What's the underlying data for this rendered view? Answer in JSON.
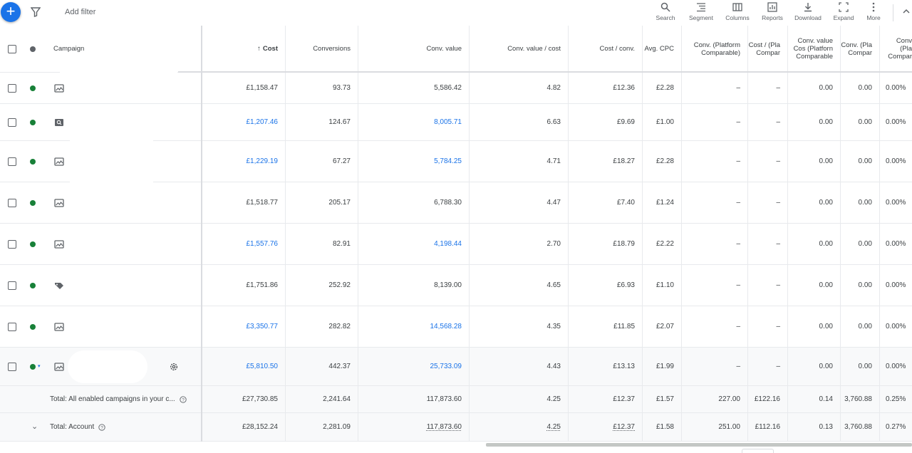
{
  "toolbar": {
    "add_filter": "Add filter",
    "tools": [
      {
        "label": "Search",
        "icon": "search-icon"
      },
      {
        "label": "Segment",
        "icon": "segment-icon"
      },
      {
        "label": "Columns",
        "icon": "columns-icon"
      },
      {
        "label": "Reports",
        "icon": "reports-icon"
      },
      {
        "label": "Download",
        "icon": "download-icon"
      },
      {
        "label": "Expand",
        "icon": "expand-icon"
      },
      {
        "label": "More",
        "icon": "more-icon"
      }
    ]
  },
  "columns": {
    "campaign": "Campaign",
    "cost": "Cost",
    "conversions": "Conversions",
    "conv_value": "Conv. value",
    "conv_value_cost": "Conv. value / cost",
    "cost_conv": "Cost / conv.",
    "avg_cpc": "Avg. CPC",
    "conv_platform": "Conv. (Platform Comparable)",
    "cost_per_platform": "Cost / (Pla Compar",
    "conv_value_cost_platform": "Conv. value Cos (Platforn Comparable",
    "conv_pla": "Conv. (Pla Compar",
    "conv_rate_pla": "Conv (Pla Compar"
  },
  "colors": {
    "accent": "#1a73e8",
    "enabled": "#188038"
  },
  "rows": [
    {
      "icon": "display-campaign-icon",
      "cost": "£1,158.47",
      "conversions": "93.73",
      "conv_value": "5,586.42",
      "vc": "4.82",
      "cpa": "£12.36",
      "cpc": "£2.28",
      "c1": "–",
      "c2": "–",
      "c3": "0.00",
      "c4": "0.00",
      "c5": "0.00%",
      "linked": false
    },
    {
      "icon": "search-campaign-icon",
      "cost": "£1,207.46",
      "conversions": "124.67",
      "conv_value": "8,005.71",
      "vc": "6.63",
      "cpa": "£9.69",
      "cpc": "£1.00",
      "c1": "–",
      "c2": "–",
      "c3": "0.00",
      "c4": "0.00",
      "c5": "0.00%",
      "linked": true
    },
    {
      "icon": "display-campaign-icon",
      "cost": "£1,229.19",
      "conversions": "67.27",
      "conv_value": "5,784.25",
      "vc": "4.71",
      "cpa": "£18.27",
      "cpc": "£2.28",
      "c1": "–",
      "c2": "–",
      "c3": "0.00",
      "c4": "0.00",
      "c5": "0.00%",
      "linked": true
    },
    {
      "icon": "display-campaign-icon",
      "cost": "£1,518.77",
      "conversions": "205.17",
      "conv_value": "6,788.30",
      "vc": "4.47",
      "cpa": "£7.40",
      "cpc": "£1.24",
      "c1": "–",
      "c2": "–",
      "c3": "0.00",
      "c4": "0.00",
      "c5": "0.00%",
      "linked": false
    },
    {
      "icon": "display-campaign-icon",
      "cost": "£1,557.76",
      "conversions": "82.91",
      "conv_value": "4,198.44",
      "vc": "2.70",
      "cpa": "£18.79",
      "cpc": "£2.22",
      "c1": "–",
      "c2": "–",
      "c3": "0.00",
      "c4": "0.00",
      "c5": "0.00%",
      "linked": true
    },
    {
      "icon": "shopping-campaign-icon",
      "cost": "£1,751.86",
      "conversions": "252.92",
      "conv_value": "8,139.00",
      "vc": "4.65",
      "cpa": "£6.93",
      "cpc": "£1.10",
      "c1": "–",
      "c2": "–",
      "c3": "0.00",
      "c4": "0.00",
      "c5": "0.00%",
      "linked": false
    },
    {
      "icon": "display-campaign-icon",
      "cost": "£3,350.77",
      "conversions": "282.82",
      "conv_value": "14,568.28",
      "vc": "4.35",
      "cpa": "£11.85",
      "cpc": "£2.07",
      "c1": "–",
      "c2": "–",
      "c3": "0.00",
      "c4": "0.00",
      "c5": "0.00%",
      "linked": true
    },
    {
      "icon": "display-campaign-icon",
      "cost": "£5,810.50",
      "conversions": "442.37",
      "conv_value": "25,733.09",
      "vc": "4.43",
      "cpa": "£13.13",
      "cpc": "£1.99",
      "c1": "–",
      "c2": "–",
      "c3": "0.00",
      "c4": "0.00",
      "c5": "0.00%",
      "linked": true
    }
  ],
  "totals": [
    {
      "label": "Total: All enabled campaigns in your c...",
      "cost": "£27,730.85",
      "conversions": "2,241.64",
      "conv_value": "117,873.60",
      "vc": "4.25",
      "cpa": "£12.37",
      "cpc": "£1.57",
      "c1": "227.00",
      "c2": "£122.16",
      "c3": "0.14",
      "c4": "3,760.88",
      "c5": "0.25%"
    },
    {
      "label": "Total: Account",
      "cost": "£28,152.24",
      "conversions": "2,281.09",
      "conv_value": "117,873.60",
      "vc": "4.25",
      "cpa": "£12.37",
      "cpc": "£1.58",
      "c1": "251.00",
      "c2": "£112.16",
      "c3": "0.13",
      "c4": "3,760.88",
      "c5": "0.27%"
    }
  ]
}
